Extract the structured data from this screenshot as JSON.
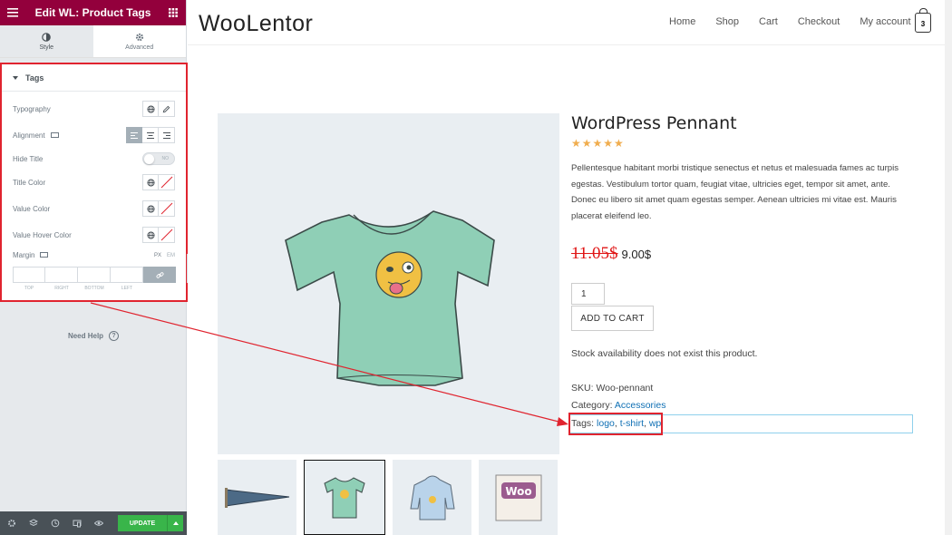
{
  "editor": {
    "title": "Edit WL: Product Tags",
    "tabs": [
      {
        "label": "Style"
      },
      {
        "label": "Advanced"
      }
    ],
    "section_title": "Tags",
    "controls": {
      "typography": "Typography",
      "alignment": "Alignment",
      "hide_title": "Hide Title",
      "hide_title_state": "NO",
      "title_color": "Title Color",
      "value_color": "Value Color",
      "value_hover_color": "Value Hover Color",
      "margin": "Margin",
      "unit_px": "PX",
      "unit_em": "EM",
      "margin_labels": [
        "TOP",
        "RIGHT",
        "BOTTOM",
        "LEFT"
      ]
    },
    "help": "Need Help",
    "update_label": "UPDATE",
    "colors": {
      "brand": "#93003c",
      "update": "#39b54a",
      "highlight": "#e0242f"
    }
  },
  "site": {
    "logo": "WooLentor",
    "nav": [
      "Home",
      "Shop",
      "Cart",
      "Checkout",
      "My account"
    ],
    "cart_count": "3"
  },
  "product": {
    "title": "WordPress Pennant",
    "rating_stars": "★★★★★",
    "description": "Pellentesque habitant morbi tristique senectus et netus et malesuada fames ac turpis egestas. Vestibulum tortor quam, feugiat vitae, ultricies eget, tempor sit amet, ante. Donec eu libero sit amet quam egestas semper. Aenean ultricies mi vitae est. Mauris placerat eleifend leo.",
    "old_price": "11.05$",
    "new_price": "9.00$",
    "quantity": "1",
    "add_to_cart": "ADD TO CART",
    "stock": "Stock availability does not exist this product.",
    "sku_label": "SKU:",
    "sku": "Woo-pennant",
    "category_label": "Category:",
    "category": "Accessories",
    "tags_label": "Tags:",
    "tags": [
      "logo",
      "t-shirt",
      "wp"
    ],
    "thumb_logo_text": "Woo"
  }
}
